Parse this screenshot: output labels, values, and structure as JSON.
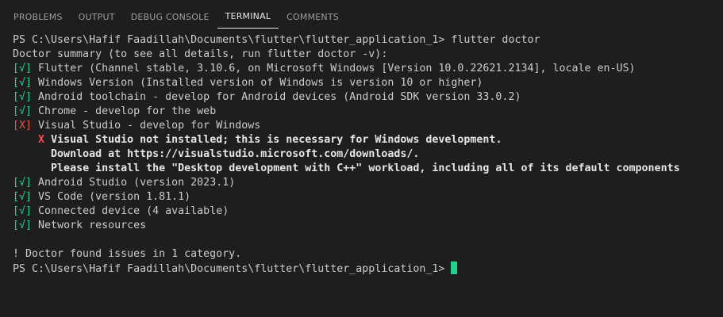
{
  "tabs": [
    {
      "label": "PROBLEMS"
    },
    {
      "label": "OUTPUT"
    },
    {
      "label": "DEBUG CONSOLE"
    },
    {
      "label": "TERMINAL"
    },
    {
      "label": "COMMENTS"
    }
  ],
  "active_tab": "TERMINAL",
  "terminal": {
    "prompt": "PS C:\\Users\\Hafif Faadillah\\Documents\\flutter\\flutter_application_1>",
    "command": "flutter doctor",
    "summary": "Doctor summary (to see all details, run flutter doctor -v):",
    "checks": [
      {
        "mark": "[√]",
        "text": "Flutter (Channel stable, 3.10.6, on Microsoft Windows [Version 10.0.22621.2134], locale en-US)"
      },
      {
        "mark": "[√]",
        "text": "Windows Version (Installed version of Windows is version 10 or higher)"
      },
      {
        "mark": "[√]",
        "text": "Android toolchain - develop for Android devices (Android SDK version 33.0.2)"
      },
      {
        "mark": "[√]",
        "text": "Chrome - develop for the web"
      },
      {
        "mark": "[X]",
        "text": "Visual Studio - develop for Windows"
      }
    ],
    "vs_error": {
      "x": "X",
      "line1": "Visual Studio not installed; this is necessary for Windows development.",
      "line2": "Download at https://visualstudio.microsoft.com/downloads/.",
      "line3": "Please install the \"Desktop development with C++\" workload, including all of its default components"
    },
    "checks_after": [
      {
        "mark": "[√]",
        "text": "Android Studio (version 2023.1)"
      },
      {
        "mark": "[√]",
        "text": "VS Code (version 1.81.1)"
      },
      {
        "mark": "[√]",
        "text": "Connected device (4 available)"
      },
      {
        "mark": "[√]",
        "text": "Network resources"
      }
    ],
    "issues": "! Doctor found issues in 1 category.",
    "final_prompt": "PS C:\\Users\\Hafif Faadillah\\Documents\\flutter\\flutter_application_1>"
  },
  "colors": {
    "background": "#1e1e1e",
    "ok": "#23d18b",
    "error": "#f14c4c",
    "text": "#cccccc",
    "tab_active": "#e7e7e7",
    "tab_inactive": "#9d9d9d"
  }
}
